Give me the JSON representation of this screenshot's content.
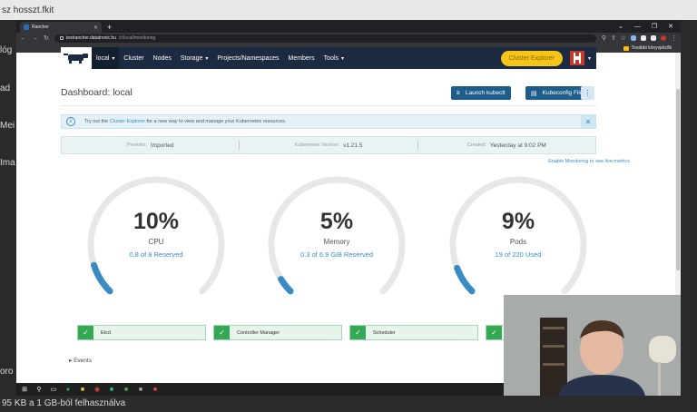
{
  "background": {
    "text_fragments": [
      "sz hosszt.fkit",
      "lóg",
      "ad",
      "Mei",
      "Ima",
      "oro",
      "95 KB a 1 GB-ból felhasználva"
    ]
  },
  "browser": {
    "tab_title": "Rancher",
    "url_host": "testrancher.datatronic.hu",
    "url_path": "/c/local/monitoring",
    "bookmark_label": "További könyvjelzők",
    "window_controls": [
      "⌄",
      "—",
      "❐",
      "✕"
    ]
  },
  "header": {
    "cluster": "local",
    "nav": [
      {
        "label": "Cluster",
        "has_caret": false
      },
      {
        "label": "Nodes",
        "has_caret": false
      },
      {
        "label": "Storage",
        "has_caret": true
      },
      {
        "label": "Projects/Namespaces",
        "has_caret": false
      },
      {
        "label": "Members",
        "has_caret": false
      },
      {
        "label": "Tools",
        "has_caret": true
      }
    ],
    "explorer_button": "Cluster Explorer"
  },
  "dashboard": {
    "title": "Dashboard: local",
    "launch_kubectl": "Launch kubectl",
    "kubeconfig": "Kubeconfig File",
    "more": "⋮"
  },
  "banner": {
    "prefix": "Try out the",
    "link": "Cluster Explorer",
    "suffix": "for a new way to view and manage your Kubernetes resources."
  },
  "facts": {
    "provider_label": "Provider:",
    "provider_value": "Imported",
    "k8s_label": "Kubernetes Version:",
    "k8s_value": "v1.21.5",
    "created_label": "Created:",
    "created_value": "Yesterday at 9:02 PM"
  },
  "monitoring_link": "Enable Monitoring to see live metrics",
  "gauges": [
    {
      "name": "cpu",
      "percent": "10%",
      "label": "CPU",
      "sub": "0.8 of 8 Reserved",
      "fraction": 0.1
    },
    {
      "name": "memory",
      "percent": "5%",
      "label": "Memory",
      "sub": "0.3 of 6.9 GiB Reserved",
      "fraction": 0.05
    },
    {
      "name": "pods",
      "percent": "9%",
      "label": "Pods",
      "sub": "19 of 220 Used",
      "fraction": 0.09
    }
  ],
  "components": [
    "Etcd",
    "Controller Manager",
    "Scheduler"
  ],
  "events_label": "Events",
  "colors": {
    "header_bg": "#1c2b42",
    "accent_blue": "#3a8bc4",
    "explorer_yellow": "#f5c518",
    "ok_green": "#35a853"
  }
}
